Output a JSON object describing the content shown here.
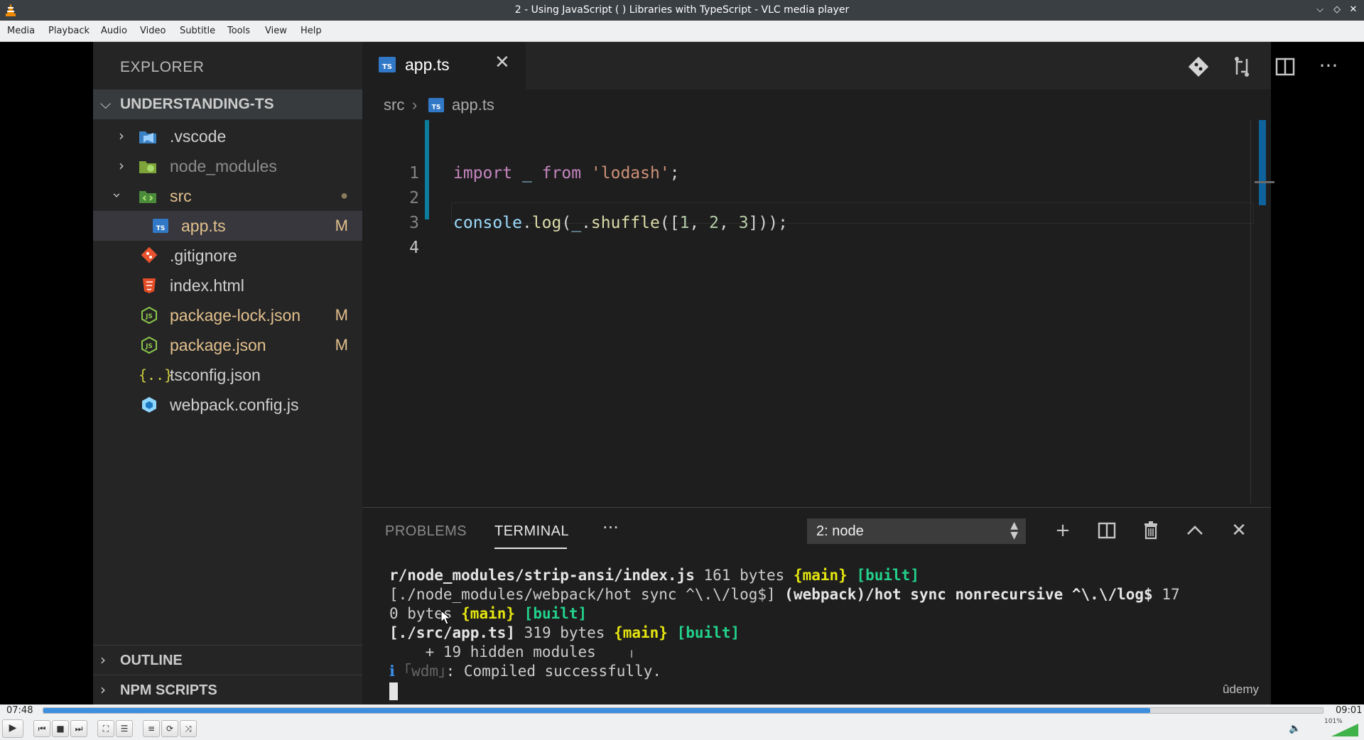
{
  "window": {
    "title": "2 - Using JavaScript ( ) Libraries with TypeScript - VLC media player"
  },
  "menu": [
    "Media",
    "Playback",
    "Audio",
    "Video",
    "Subtitle",
    "Tools",
    "View",
    "Help"
  ],
  "explorer": {
    "title": "EXPLORER",
    "project": "UNDERSTANDING-TS",
    "items": [
      {
        "name": ".vscode",
        "badge": ""
      },
      {
        "name": "node_modules",
        "badge": ""
      },
      {
        "name": "src",
        "badge": "●"
      },
      {
        "name": "app.ts",
        "badge": "M"
      },
      {
        "name": ".gitignore",
        "badge": ""
      },
      {
        "name": "index.html",
        "badge": ""
      },
      {
        "name": "package-lock.json",
        "badge": "M"
      },
      {
        "name": "package.json",
        "badge": "M"
      },
      {
        "name": "tsconfig.json",
        "badge": ""
      },
      {
        "name": "webpack.config.js",
        "badge": ""
      }
    ],
    "sections": [
      "OUTLINE",
      "NPM SCRIPTS"
    ]
  },
  "editor": {
    "tab": "app.ts",
    "breadcrumb": [
      "src",
      "app.ts"
    ],
    "line_numbers": [
      "1",
      "2",
      "3",
      "4"
    ],
    "code": {
      "l1": {
        "kw1": "import",
        "var": "_",
        "kw2": "from",
        "str": "'lodash'",
        "end": ";"
      },
      "l3": {
        "obj": "console",
        "dot": ".",
        "fn": "log",
        "open": "(",
        "var": "_",
        "dot2": ".",
        "fn2": "shuffle",
        "open2": "([",
        "n1": "1",
        "c1": ", ",
        "n2": "2",
        "c2": ", ",
        "n3": "3",
        "close": "]));"
      }
    }
  },
  "panel": {
    "tabs": [
      "PROBLEMS",
      "TERMINAL"
    ],
    "more": "···",
    "terminal_select": "2: node",
    "output": {
      "l1": {
        "a": "r/node_modules/strip-ansi/index.js",
        "b": " 161 bytes ",
        "c": "{main}",
        "d": " ",
        "e": "[built]"
      },
      "l2": {
        "a": "[./node_modules/webpack/hot sync ^\\.\\/log$] ",
        "b": "(webpack)/hot sync nonrecursive ^\\.\\/log$",
        "c": " 17"
      },
      "l3": {
        "a": "0 bytes ",
        "b": "{main}",
        "c": " ",
        "d": "[built]"
      },
      "l4": {
        "a": "[./src/app.ts]",
        "b": " 319 bytes ",
        "c": "{main}",
        "d": " ",
        "e": "[built]"
      },
      "l5": "    + 19 hidden modules",
      "l6": {
        "a": "ℹ",
        "b": " ｢wdm｣",
        "c": ": Compiled successfully."
      }
    }
  },
  "watermark": "ûdemy",
  "player": {
    "elapsed": "07:48",
    "total": "09:01",
    "progress_fraction": 0.865,
    "volume_label": "101%",
    "volume_fraction": 1.0
  },
  "colors": {
    "accent": "#3c8ede",
    "ts_blue": "#3178c6",
    "modified": "#e2c08d"
  }
}
